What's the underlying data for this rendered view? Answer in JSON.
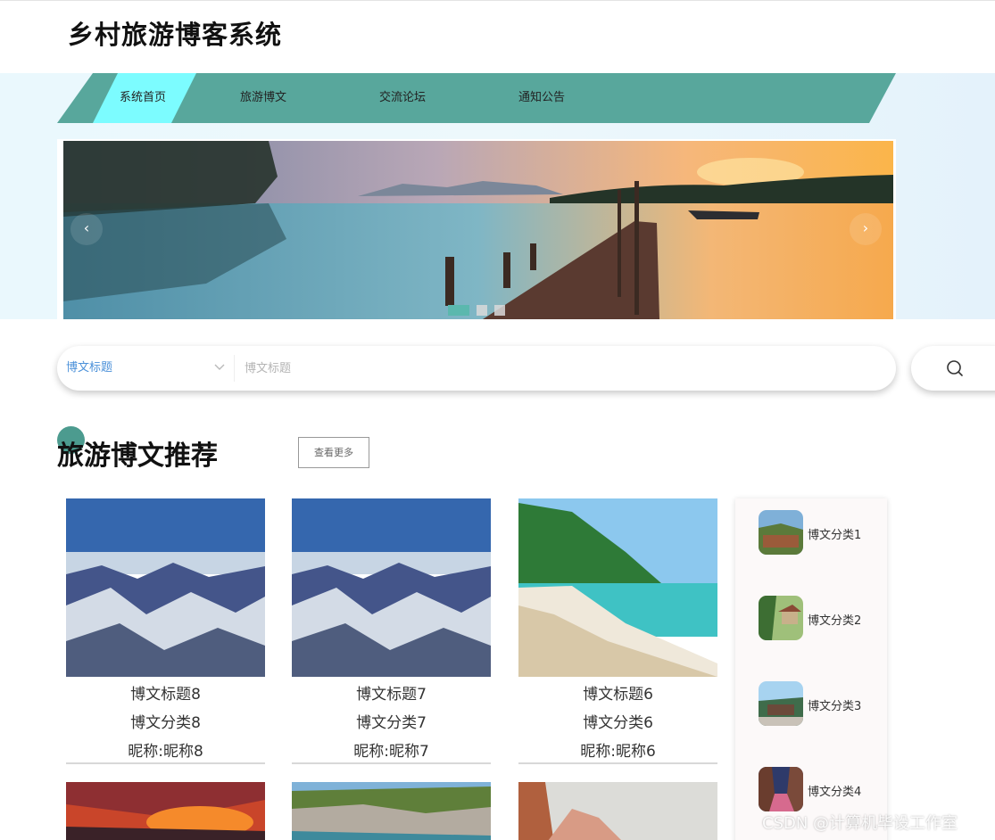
{
  "site": {
    "title": "乡村旅游博客系统"
  },
  "nav": {
    "items": [
      "系统首页",
      "旅游博文",
      "交流论坛",
      "通知公告"
    ],
    "active_index": 0
  },
  "banner": {
    "prev_icon": "chevron-left",
    "next_icon": "chevron-right",
    "slide_count": 3,
    "active_slide": 0
  },
  "search": {
    "field_selected": "博文标题",
    "placeholder": "博文标题",
    "icon": "search-icon"
  },
  "section": {
    "title": "旅游博文推荐",
    "more_label": "查看更多"
  },
  "posts": [
    {
      "title": "博文标题8",
      "category": "博文分类8",
      "nickname": "昵称:昵称8",
      "image": "mountains"
    },
    {
      "title": "博文标题7",
      "category": "博文分类7",
      "nickname": "昵称:昵称7",
      "image": "mountains"
    },
    {
      "title": "博文标题6",
      "category": "博文分类6",
      "nickname": "昵称:昵称6",
      "image": "beach"
    }
  ],
  "categories": [
    {
      "label": "博文分类1",
      "image": "village"
    },
    {
      "label": "博文分类2",
      "image": "forest-pavilion"
    },
    {
      "label": "博文分类3",
      "image": "temple"
    },
    {
      "label": "博文分类4",
      "image": "old-street"
    }
  ],
  "colors": {
    "nav_bg": "#58a79c",
    "nav_active": "#7cfcff",
    "accent_dot": "#4c9b8f",
    "select_text": "#4a90d9"
  },
  "watermark": "CSDN @计算机毕设工作室"
}
